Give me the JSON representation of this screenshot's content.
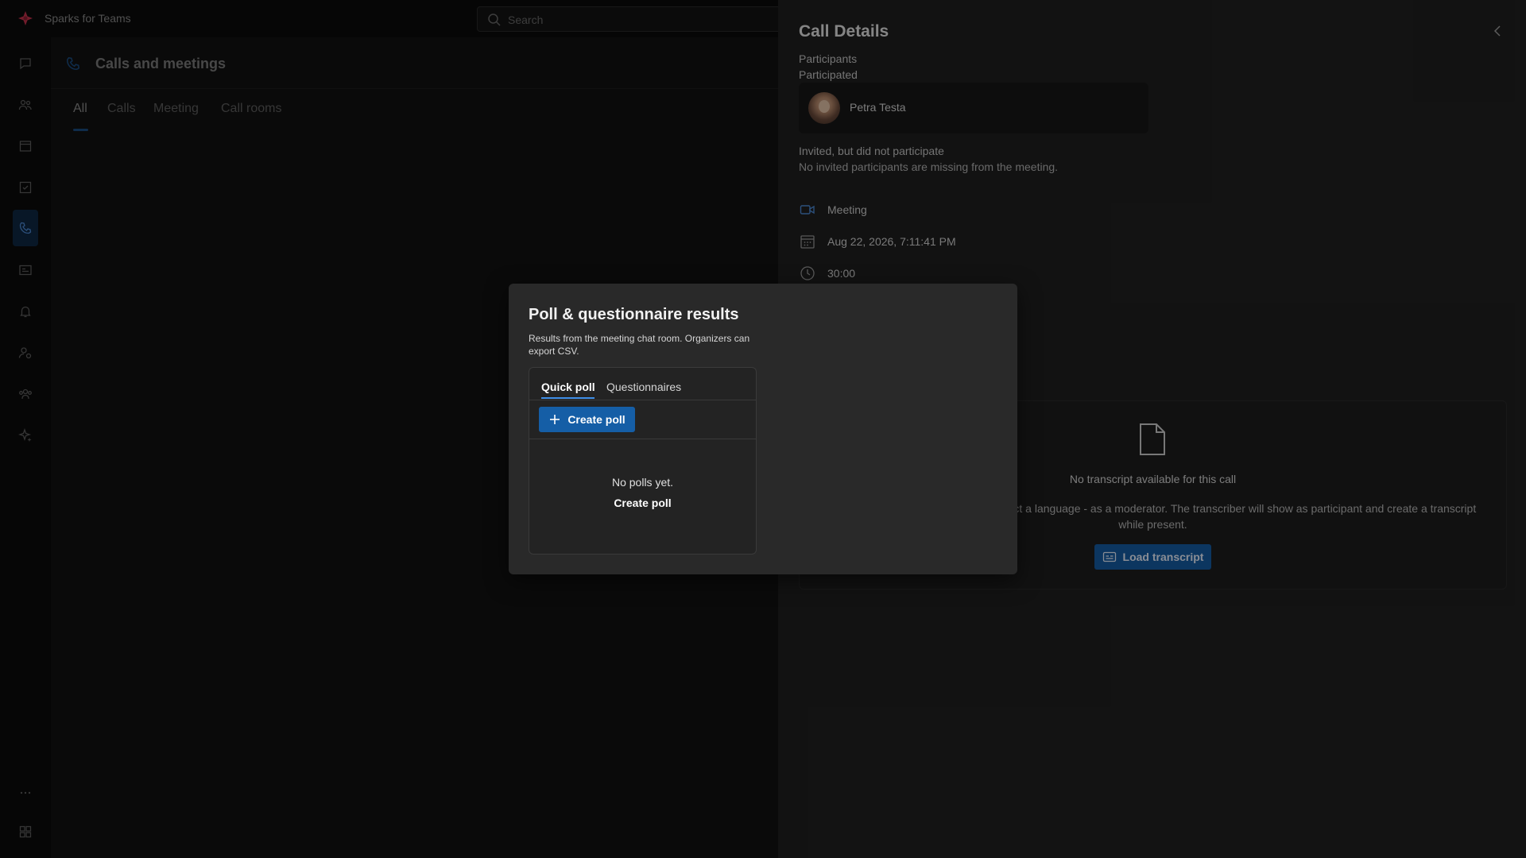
{
  "app": {
    "name": "Sparks for Teams"
  },
  "search": {
    "placeholder": "Search"
  },
  "rail": {
    "items": [
      {
        "icon": "chat-icon"
      },
      {
        "icon": "people-icon"
      },
      {
        "icon": "calendar-icon"
      },
      {
        "icon": "tasks-icon"
      },
      {
        "icon": "phone-icon",
        "active": true
      },
      {
        "icon": "contact-card-icon"
      },
      {
        "icon": "bell-icon"
      },
      {
        "icon": "person-settings-icon"
      },
      {
        "icon": "teams-icon"
      },
      {
        "icon": "sparkle-icon"
      }
    ],
    "bottom": [
      {
        "icon": "more-icon"
      },
      {
        "icon": "apps-icon"
      }
    ]
  },
  "main": {
    "title": "Calls and meetings",
    "tabs": [
      {
        "label": "All",
        "active": true
      },
      {
        "label": "Calls"
      },
      {
        "label": "Meeting"
      },
      {
        "label": "Call rooms"
      }
    ]
  },
  "details": {
    "title": "Call Details",
    "participants_label": "Participants",
    "participated_label": "Participated",
    "participant": {
      "name": "Petra Testa"
    },
    "invited_label": "Invited, but did not participate",
    "invited_note": "No invited participants are missing from the meeting.",
    "type": "Meeting",
    "datetime": "Aug 22, 2026, 7:11:41 PM",
    "duration": "30:00",
    "transcript": {
      "title": "No transcript available for this call",
      "description": "y. In a session goto subtitles and select a language - as a moderator. The transcriber will show as participant and create a transcript while present.",
      "button": "Load transcript"
    }
  },
  "modal": {
    "title": "Poll & questionnaire results",
    "subtitle": "Results from the meeting chat room. Organizers can export CSV.",
    "tabs": [
      {
        "label": "Quick poll",
        "active": true
      },
      {
        "label": "Questionnaires"
      }
    ],
    "create_button": "Create poll",
    "empty_text": "No polls yet.",
    "empty_link": "Create poll"
  },
  "colors": {
    "accent": "#155ea6",
    "tab_underline": "#3f8fe8",
    "panel_bg": "#202020",
    "modal_bg": "#292929"
  }
}
